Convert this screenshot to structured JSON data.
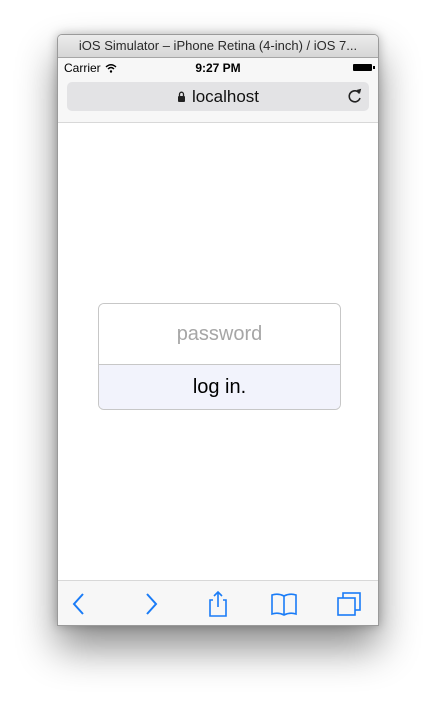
{
  "window": {
    "title": "iOS Simulator – iPhone Retina (4-inch) / iOS 7..."
  },
  "statusbar": {
    "carrier": "Carrier",
    "time": "9:27 PM",
    "icons": [
      "wifi-icon",
      "battery-icon"
    ]
  },
  "browser": {
    "url": "localhost",
    "icons": [
      "lock-icon",
      "reload-icon"
    ]
  },
  "login": {
    "password_placeholder": "password",
    "password_value": "",
    "button_label": "log in."
  },
  "toolbar": {
    "icons": [
      "back-icon",
      "forward-icon",
      "share-icon",
      "bookmarks-icon",
      "tabs-icon"
    ]
  },
  "colors": {
    "ios_blue": "#1a7cf7",
    "button_bg": "#f2f3fc",
    "border": "#c7c7c7"
  }
}
